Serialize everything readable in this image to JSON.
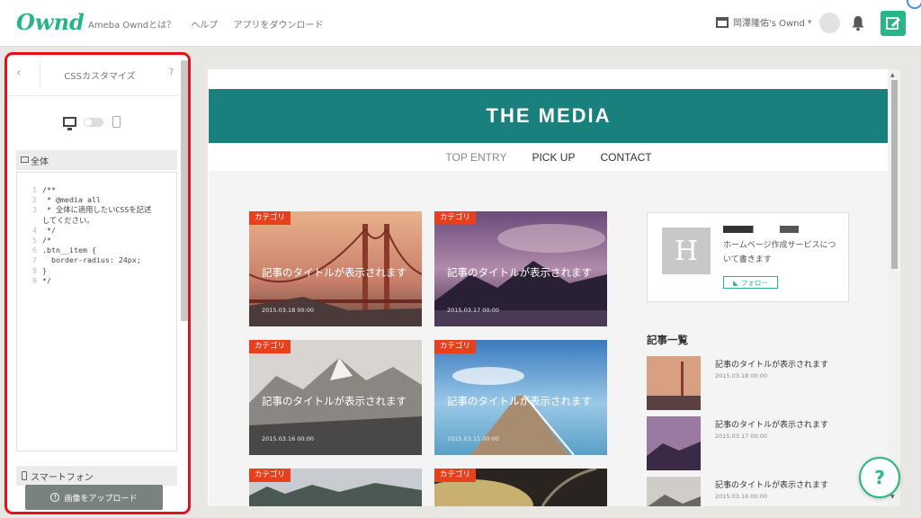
{
  "header": {
    "logo": "Ownd",
    "nav": [
      "Ameba Owndとは？",
      "ヘルプ",
      "アプリをダウンロード"
    ],
    "site_name": "岡澤隆佑's Ownd"
  },
  "sidebar": {
    "title": "CSSカスタマイズ",
    "back": "‹",
    "help": "?",
    "section_all": "全体",
    "section_phone": "スマートフォン",
    "upload_label": "画像をアップロード",
    "code_lines": [
      {
        "n": "1",
        "t": "/**"
      },
      {
        "n": "2",
        "t": " * @media all"
      },
      {
        "n": "3",
        "t": " * 全体に適用したいCSSを記述"
      },
      {
        "n": "",
        "t": "してください。"
      },
      {
        "n": "4",
        "t": " */"
      },
      {
        "n": "5",
        "t": "/*"
      },
      {
        "n": "6",
        "t": ".btn__item {"
      },
      {
        "n": "7",
        "t": "  border-radius: 24px;"
      },
      {
        "n": "8",
        "t": "}"
      },
      {
        "n": "9",
        "t": "*/"
      }
    ]
  },
  "preview": {
    "site_title": "THE MEDIA",
    "nav": [
      "TOP ENTRY",
      "PICK UP",
      "CONTACT"
    ],
    "cards": [
      {
        "category": "カテゴリ",
        "title": "記事のタイトルが表示されます",
        "date": "2015.03.18 00:00"
      },
      {
        "category": "カテゴリ",
        "title": "記事のタイトルが表示されます",
        "date": "2015.03.17 00:00"
      },
      {
        "category": "カテゴリ",
        "title": "記事のタイトルが表示されます",
        "date": "2015.03.16 00:00"
      },
      {
        "category": "カテゴリ",
        "title": "記事のタイトルが表示されます",
        "date": "2015.03.15 00:00"
      },
      {
        "category": "カテゴリ",
        "title": "",
        "date": ""
      },
      {
        "category": "カテゴリ",
        "title": "",
        "date": ""
      }
    ],
    "profile": {
      "initial": "H",
      "description": "ホームページ作成サービスについて書きます",
      "follow_label": "フォロー"
    },
    "list_heading": "記事一覧",
    "list": [
      {
        "title": "記事のタイトルが表示されます",
        "date": "2015.03.18 00:00"
      },
      {
        "title": "記事のタイトルが表示されます",
        "date": "2015.03.17 00:00"
      },
      {
        "title": "記事のタイトルが表示されます",
        "date": "2015.03.16 00:00"
      }
    ]
  },
  "help_fab": "?",
  "colors": {
    "brand": "#2ab588",
    "hero": "#19807d",
    "category": "#e8401c",
    "highlight": "#e0131b"
  }
}
